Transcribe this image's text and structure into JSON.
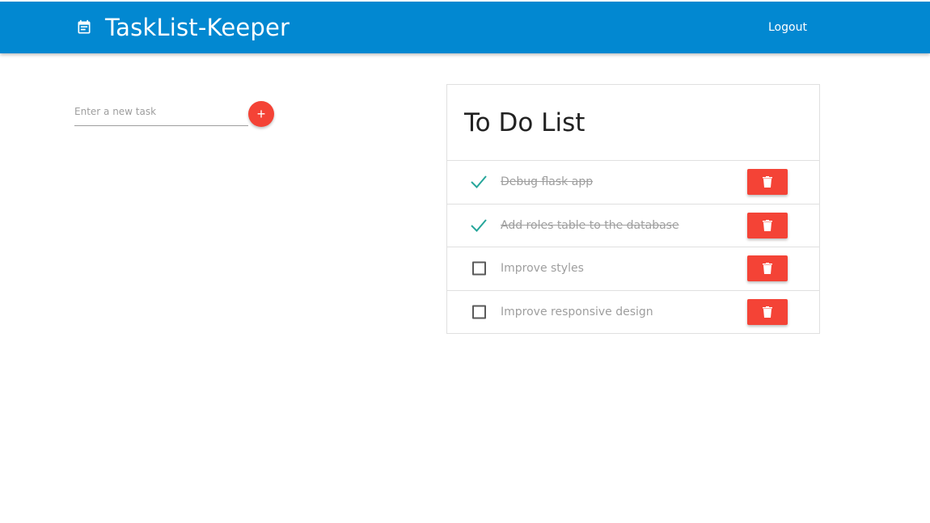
{
  "header": {
    "app_title": "TaskList-Keeper",
    "brand_icon": "calendar-icon",
    "logout_label": "Logout",
    "bg_color": "#0288d1"
  },
  "new_task": {
    "placeholder": "Enter a new task",
    "value": "",
    "add_button_label": "+",
    "add_button_color": "#f44336"
  },
  "todo": {
    "title": "To Do List",
    "tasks": [
      {
        "label": "Debug flask app",
        "done": true
      },
      {
        "label": "Add roles table to the database",
        "done": true
      },
      {
        "label": "Improve styles",
        "done": false
      },
      {
        "label": "Improve responsive design",
        "done": false
      }
    ],
    "delete_icon": "trash-icon",
    "check_color": "#26a69a",
    "delete_color": "#f44336"
  }
}
